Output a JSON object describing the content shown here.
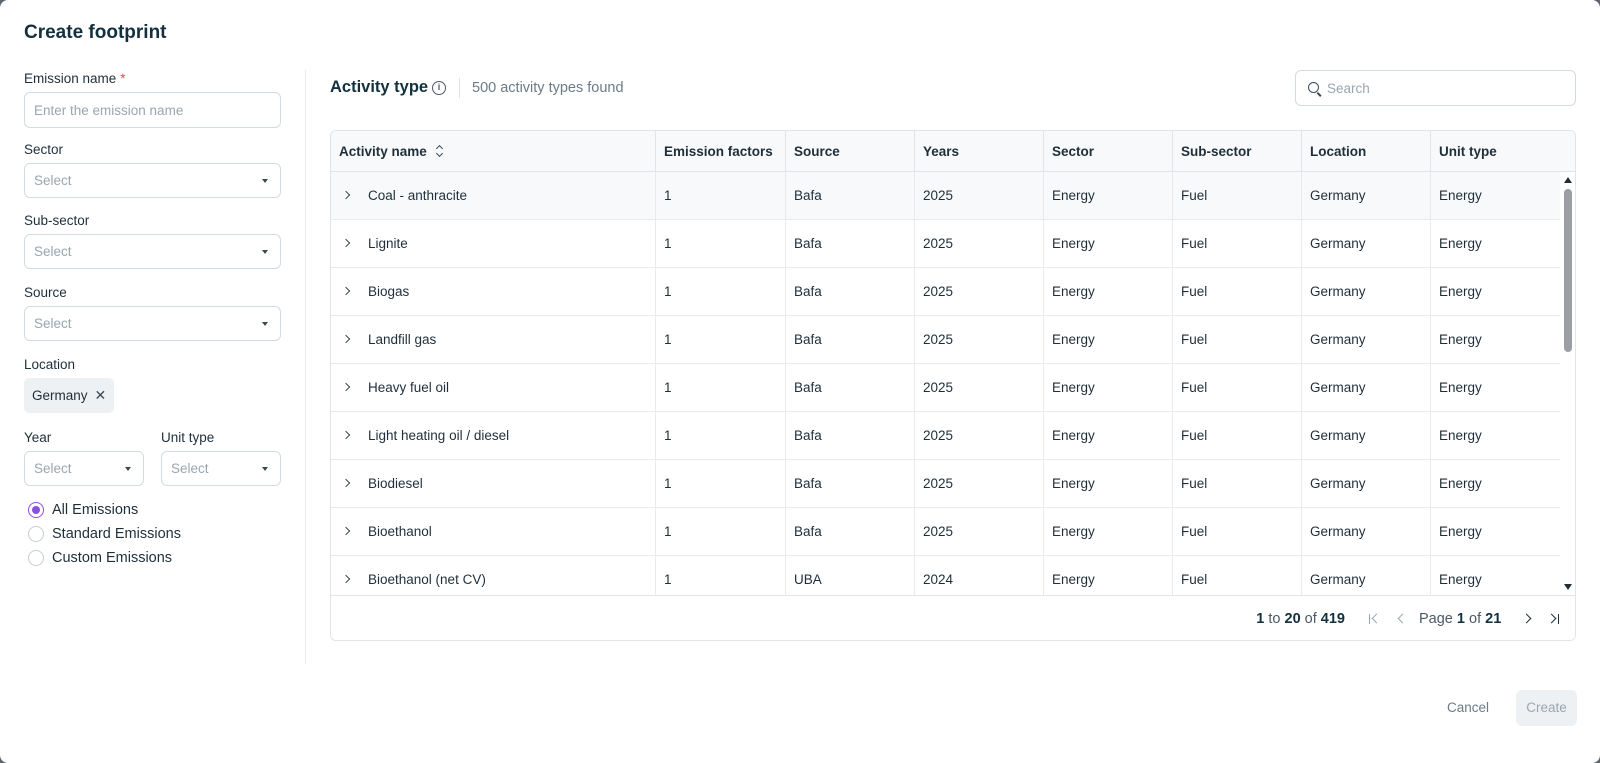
{
  "modal": {
    "title": "Create footprint"
  },
  "form": {
    "emission_name": {
      "label": "Emission name",
      "required_mark": "*",
      "placeholder": "Enter the emission name"
    },
    "sector": {
      "label": "Sector",
      "placeholder": "Select"
    },
    "sub_sector": {
      "label": "Sub-sector",
      "placeholder": "Select"
    },
    "source": {
      "label": "Source",
      "placeholder": "Select"
    },
    "location": {
      "label": "Location",
      "chip": "Germany",
      "chip_remove": "✕"
    },
    "year": {
      "label": "Year",
      "placeholder": "Select"
    },
    "unit_type": {
      "label": "Unit type",
      "placeholder": "Select"
    },
    "emission_filter": {
      "selected": "All Emissions",
      "options": [
        "All Emissions",
        "Standard Emissions",
        "Custom Emissions"
      ]
    }
  },
  "activity": {
    "title": "Activity type",
    "info_icon": "i",
    "count": "500 activity types found",
    "search_placeholder": "Search"
  },
  "table": {
    "columns": [
      "Activity name",
      "Emission factors",
      "Source",
      "Years",
      "Sector",
      "Sub-sector",
      "Location",
      "Unit type"
    ],
    "rows": [
      [
        "Coal - anthracite",
        "1",
        "Bafa",
        "2025",
        "Energy",
        "Fuel",
        "Germany",
        "Energy"
      ],
      [
        "Lignite",
        "1",
        "Bafa",
        "2025",
        "Energy",
        "Fuel",
        "Germany",
        "Energy"
      ],
      [
        "Biogas",
        "1",
        "Bafa",
        "2025",
        "Energy",
        "Fuel",
        "Germany",
        "Energy"
      ],
      [
        "Landfill gas",
        "1",
        "Bafa",
        "2025",
        "Energy",
        "Fuel",
        "Germany",
        "Energy"
      ],
      [
        "Heavy fuel oil",
        "1",
        "Bafa",
        "2025",
        "Energy",
        "Fuel",
        "Germany",
        "Energy"
      ],
      [
        "Light heating oil / diesel",
        "1",
        "Bafa",
        "2025",
        "Energy",
        "Fuel",
        "Germany",
        "Energy"
      ],
      [
        "Biodiesel",
        "1",
        "Bafa",
        "2025",
        "Energy",
        "Fuel",
        "Germany",
        "Energy"
      ],
      [
        "Bioethanol",
        "1",
        "Bafa",
        "2025",
        "Energy",
        "Fuel",
        "Germany",
        "Energy"
      ],
      [
        "Bioethanol (net CV)",
        "1",
        "UBA",
        "2024",
        "Energy",
        "Fuel",
        "Germany",
        "Energy"
      ]
    ]
  },
  "pagination": {
    "from": "1",
    "to_word": "to",
    "to": "20",
    "of_word": "of",
    "total": "419",
    "page_word": "Page",
    "page": "1",
    "page_of_word": "of",
    "pages": "21"
  },
  "actions": {
    "cancel": "Cancel",
    "create": "Create"
  },
  "colors": {
    "accent": "#8b4fe0",
    "required": "#e5484d",
    "title": "#13303f"
  }
}
